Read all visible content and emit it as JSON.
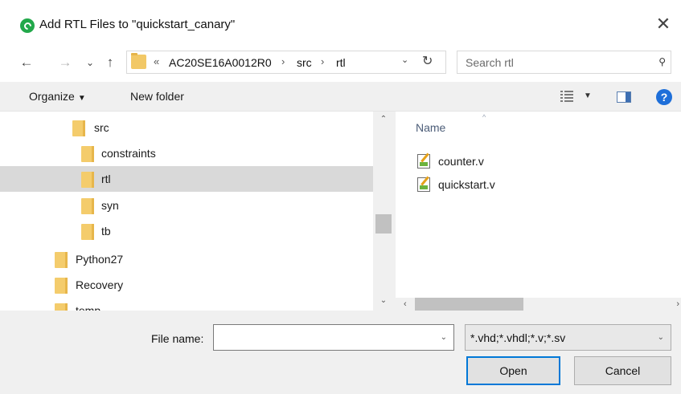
{
  "window": {
    "title": "Add RTL Files to \"quickstart_canary\"",
    "app_icon": "green-circle-app-icon",
    "close_glyph": "✕"
  },
  "nav": {
    "back_glyph": "←",
    "forward_glyph": "→",
    "recent_glyph": "⌄",
    "up_glyph": "↑",
    "overflow": "«",
    "breadcrumbs": [
      "AC20SE16A0012R0",
      "src",
      "rtl"
    ],
    "separator": "›",
    "address_dropdown_glyph": "⌄",
    "refresh_glyph": "↻"
  },
  "search": {
    "placeholder": "Search rtl",
    "icon_glyph": "⚲"
  },
  "toolbar": {
    "organize_label": "Organize",
    "organize_caret": "▼",
    "new_folder_label": "New folder",
    "views_caret": "▼",
    "help_label": "?"
  },
  "tree": {
    "items": [
      {
        "label": "src",
        "selected": false
      },
      {
        "label": "constraints",
        "selected": false
      },
      {
        "label": "rtl",
        "selected": true
      },
      {
        "label": "syn",
        "selected": false
      },
      {
        "label": "tb",
        "selected": false
      },
      {
        "label": "Python27",
        "selected": false
      },
      {
        "label": "Recovery",
        "selected": false
      },
      {
        "label": "temp",
        "selected": false
      }
    ],
    "scroll_up_glyph": "⌃",
    "scroll_down_glyph": "⌄"
  },
  "files": {
    "column_header": "Name",
    "sort_glyph": "^",
    "items": [
      "counter.v",
      "quickstart.v"
    ],
    "scroll_left_glyph": "‹",
    "scroll_right_glyph": "›"
  },
  "footer": {
    "file_name_label": "File name:",
    "file_name_value": "",
    "file_name_dropdown_glyph": "⌄",
    "filter_value": "*.vhd;*.vhdl;*.v;*.sv",
    "filter_dropdown_glyph": "⌄",
    "open_label": "Open",
    "cancel_label": "Cancel"
  },
  "colors": {
    "accent": "#0078d7",
    "selection": "#d9d9d9",
    "folder": "#f4cc6c",
    "chrome": "#f0f0f0",
    "help": "#1e6fd9"
  }
}
